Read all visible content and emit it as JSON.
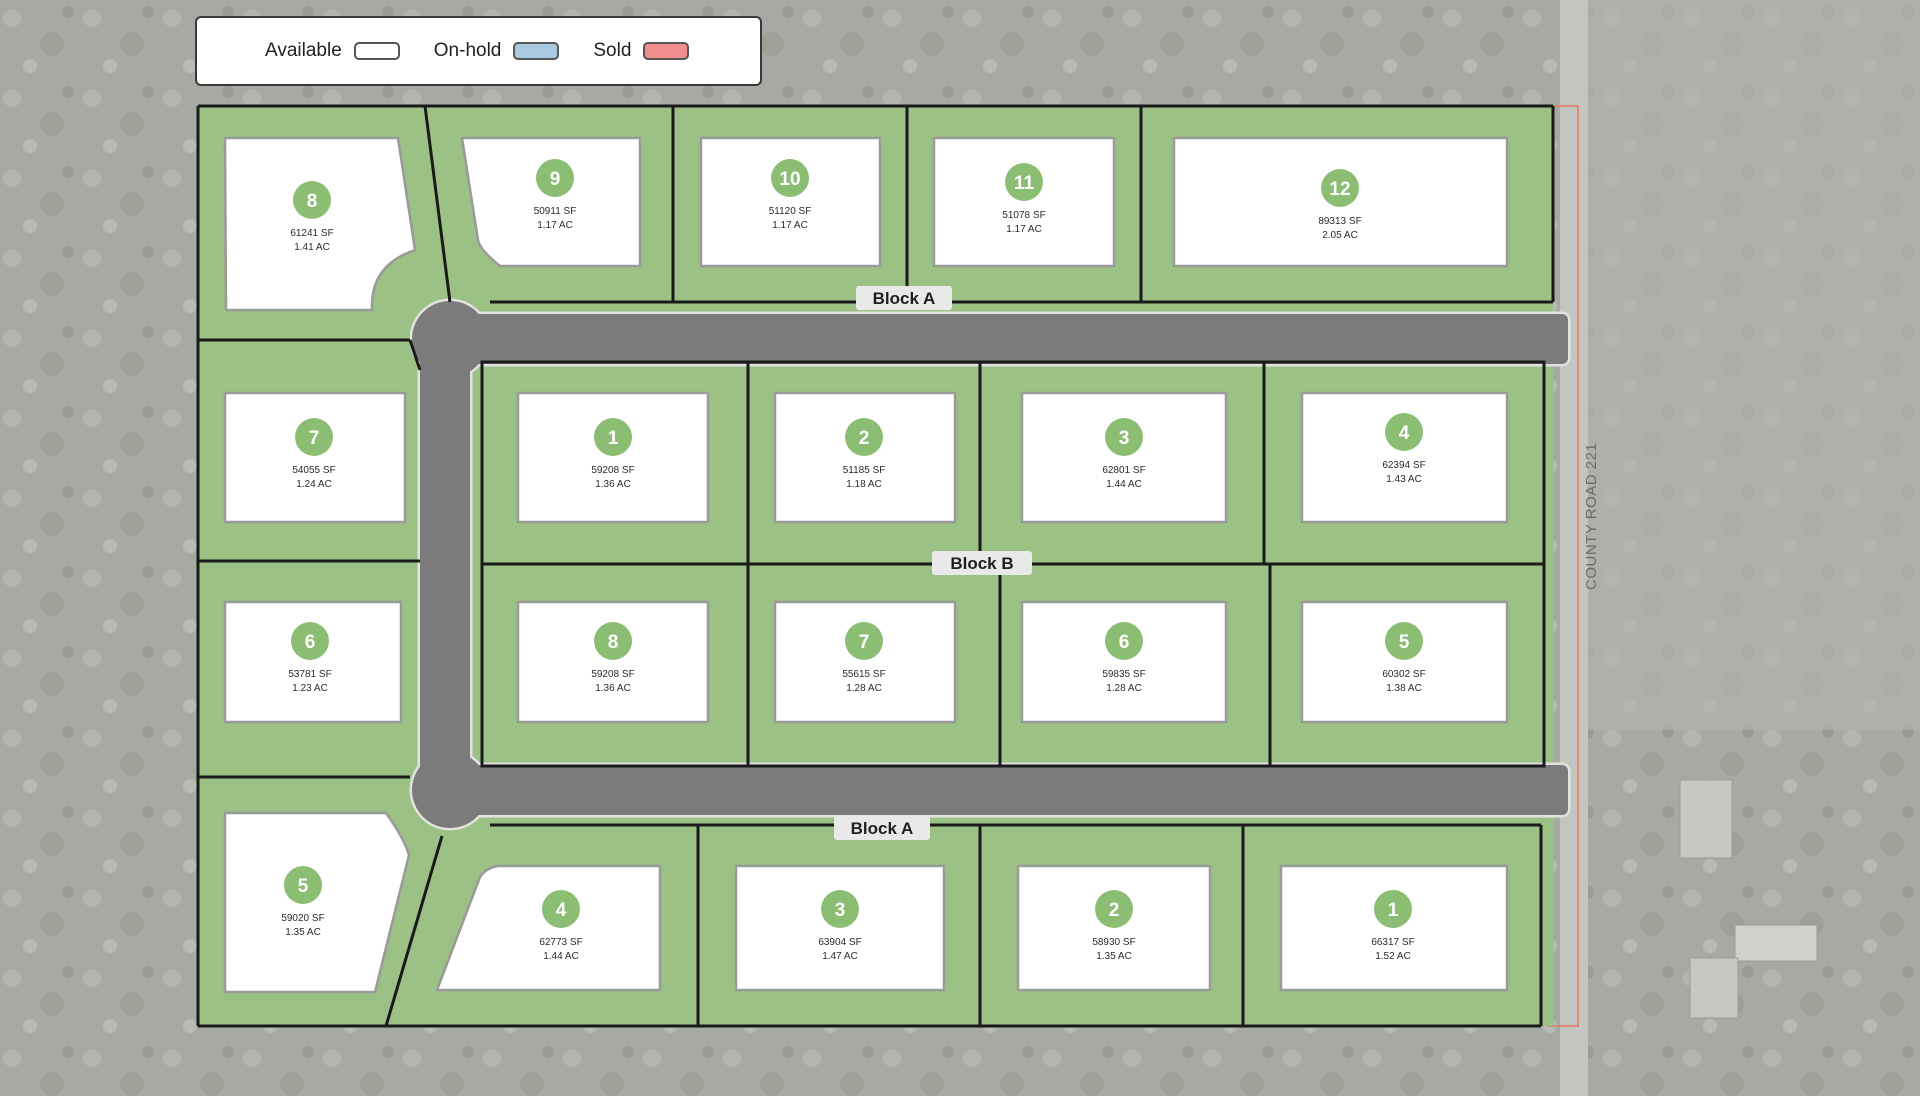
{
  "legend": {
    "items": [
      {
        "label": "Available",
        "color": "#ffffff"
      },
      {
        "label": "On-hold",
        "color": "#a9c9e0"
      },
      {
        "label": "Sold",
        "color": "#f08d8d"
      }
    ]
  },
  "colors": {
    "lot_fill": "#9bc184",
    "lot_border": "#1a1a1a",
    "road": "#7b7b7b",
    "lot_badge": "#8bbd73",
    "available_fill": "#ffffff",
    "parcel_outline": "#e8775e"
  },
  "road_label": "COUNTY ROAD 221",
  "block_labels": [
    "Block A",
    "Block B",
    "Block A"
  ],
  "lots": [
    {
      "number": "8",
      "area_sf": "61241 SF",
      "area_ac": "1.41 AC",
      "status": "available"
    },
    {
      "number": "9",
      "area_sf": "50911 SF",
      "area_ac": "1.17 AC",
      "status": "available"
    },
    {
      "number": "10",
      "area_sf": "51120 SF",
      "area_ac": "1.17 AC",
      "status": "available"
    },
    {
      "number": "11",
      "area_sf": "51078 SF",
      "area_ac": "1.17 AC",
      "status": "available"
    },
    {
      "number": "12",
      "area_sf": "89313 SF",
      "area_ac": "2.05 AC",
      "status": "available"
    },
    {
      "number": "7",
      "area_sf": "54055 SF",
      "area_ac": "1.24 AC",
      "status": "available"
    },
    {
      "number": "6",
      "area_sf": "53781 SF",
      "area_ac": "1.23 AC",
      "status": "available"
    },
    {
      "number": "5",
      "area_sf": "59020 SF",
      "area_ac": "1.35 AC",
      "status": "available"
    },
    {
      "number": "1",
      "area_sf": "59208 SF",
      "area_ac": "1.36 AC",
      "status": "available"
    },
    {
      "number": "2",
      "area_sf": "51185 SF",
      "area_ac": "1.18 AC",
      "status": "available"
    },
    {
      "number": "3",
      "area_sf": "62801 SF",
      "area_ac": "1.44 AC",
      "status": "available"
    },
    {
      "number": "4",
      "area_sf": "62394 SF",
      "area_ac": "1.43 AC",
      "status": "available"
    },
    {
      "number": "8",
      "area_sf": "59208 SF",
      "area_ac": "1.36 AC",
      "status": "available"
    },
    {
      "number": "7",
      "area_sf": "55615 SF",
      "area_ac": "1.28 AC",
      "status": "available"
    },
    {
      "number": "6",
      "area_sf": "59835 SF",
      "area_ac": "1.28 AC",
      "status": "available"
    },
    {
      "number": "5",
      "area_sf": "60302 SF",
      "area_ac": "1.38 AC",
      "status": "available"
    },
    {
      "number": "4",
      "area_sf": "62773 SF",
      "area_ac": "1.44 AC",
      "status": "available"
    },
    {
      "number": "3",
      "area_sf": "63904 SF",
      "area_ac": "1.47 AC",
      "status": "available"
    },
    {
      "number": "2",
      "area_sf": "58930 SF",
      "area_ac": "1.35 AC",
      "status": "available"
    },
    {
      "number": "1",
      "area_sf": "66317 SF",
      "area_ac": "1.52 AC",
      "status": "available"
    }
  ]
}
